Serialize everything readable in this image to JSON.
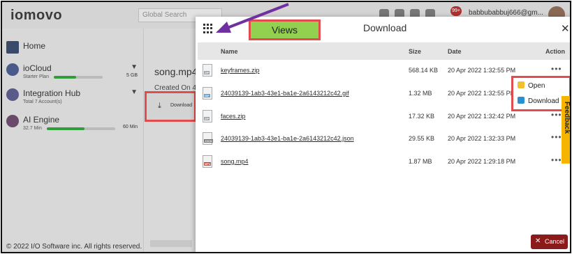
{
  "app": {
    "logo_text": "iomovo",
    "search_placeholder": "Global Search",
    "notification_count": "99+",
    "user_email": "babbubabbuj666@gm..."
  },
  "sidebar": {
    "home": "Home",
    "iocloud": {
      "title": "ioCloud",
      "plan": "Starter Plan",
      "storage": "5 GB",
      "usage_fraction": 0.45
    },
    "hub": {
      "title": "Integration Hub",
      "sub": "Total 7 Account(s)"
    },
    "ai": {
      "title": "AI Engine",
      "used": "32.7 Min",
      "total": "60 Min",
      "usage_fraction": 0.55
    },
    "copyright": "© 2022 I/O Software inc. All rights reserved."
  },
  "background": {
    "file_title": "song.mp4",
    "created_on": "Created On 4",
    "download_label": "Download"
  },
  "modal": {
    "title": "Download",
    "views_callout": "Views",
    "columns": {
      "name": "Name",
      "size": "Size",
      "date": "Date",
      "action": "Action"
    },
    "files": [
      {
        "name": "keyframes.zip",
        "type": "ZIP",
        "size": "568.14 KB",
        "date": "20 Apr 2022 1:32:55 PM"
      },
      {
        "name": "24039139-1ab3-43e1-ba1e-2a6143212c42.gif",
        "type": "GIF",
        "size": "1.32 MB",
        "date": "20 Apr 2022 1:32:55 PM"
      },
      {
        "name": "faces.zip",
        "type": "ZIP",
        "size": "17.32 KB",
        "date": "20 Apr 2022 1:32:42 PM"
      },
      {
        "name": "24039139-1ab3-43e1-ba1e-2a6143212c42.json",
        "type": "JSON",
        "size": "29.55 KB",
        "date": "20 Apr 2022 1:32:33 PM"
      },
      {
        "name": "song.mp4",
        "type": "MP4",
        "size": "1.87 MB",
        "date": "20 Apr 2022 1:29:18 PM"
      }
    ],
    "action_menu": {
      "open": "Open",
      "download": "Download"
    },
    "cancel_label": "Cancel",
    "feedback_label": "Feedback"
  },
  "colors": {
    "callout_border": "#e24c4c",
    "views_bg": "#92d050",
    "arrow": "#7030a0",
    "cancel_bg": "#8b1a1a",
    "progress": "#2e9d3a"
  }
}
